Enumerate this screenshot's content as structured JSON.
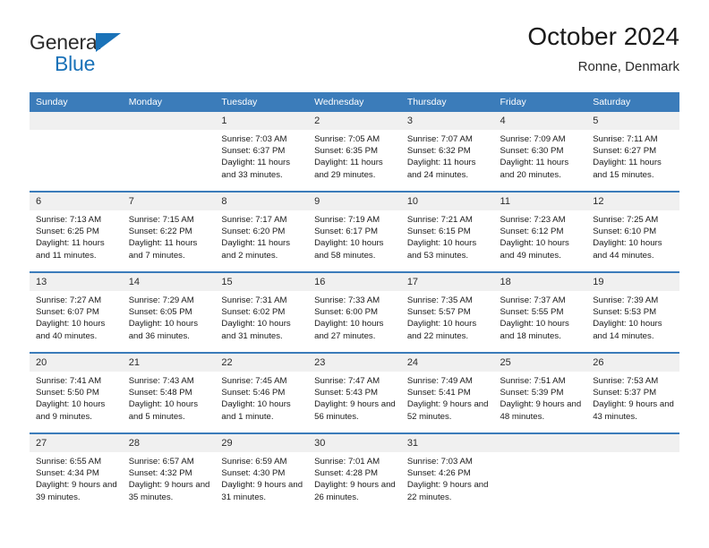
{
  "brand": {
    "name_part1": "General",
    "name_part2": "Blue",
    "accent_color": "#1a72b8"
  },
  "header": {
    "title": "October 2024",
    "subtitle": "Ronne, Denmark"
  },
  "theme": {
    "header_blue": "#3b7cba",
    "day_band_gray": "#f0f0f0",
    "text_color": "#1a1a1a"
  },
  "calendar": {
    "weekday_headers": [
      "Sunday",
      "Monday",
      "Tuesday",
      "Wednesday",
      "Thursday",
      "Friday",
      "Saturday"
    ],
    "labels": {
      "sunrise": "Sunrise:",
      "sunset": "Sunset:",
      "daylight": "Daylight:"
    },
    "weeks": [
      [
        {
          "day": "",
          "empty": true
        },
        {
          "day": "",
          "empty": true
        },
        {
          "day": "1",
          "sunrise": "Sunrise: 7:03 AM",
          "sunset": "Sunset: 6:37 PM",
          "daylight": "Daylight: 11 hours and 33 minutes."
        },
        {
          "day": "2",
          "sunrise": "Sunrise: 7:05 AM",
          "sunset": "Sunset: 6:35 PM",
          "daylight": "Daylight: 11 hours and 29 minutes."
        },
        {
          "day": "3",
          "sunrise": "Sunrise: 7:07 AM",
          "sunset": "Sunset: 6:32 PM",
          "daylight": "Daylight: 11 hours and 24 minutes."
        },
        {
          "day": "4",
          "sunrise": "Sunrise: 7:09 AM",
          "sunset": "Sunset: 6:30 PM",
          "daylight": "Daylight: 11 hours and 20 minutes."
        },
        {
          "day": "5",
          "sunrise": "Sunrise: 7:11 AM",
          "sunset": "Sunset: 6:27 PM",
          "daylight": "Daylight: 11 hours and 15 minutes."
        }
      ],
      [
        {
          "day": "6",
          "sunrise": "Sunrise: 7:13 AM",
          "sunset": "Sunset: 6:25 PM",
          "daylight": "Daylight: 11 hours and 11 minutes."
        },
        {
          "day": "7",
          "sunrise": "Sunrise: 7:15 AM",
          "sunset": "Sunset: 6:22 PM",
          "daylight": "Daylight: 11 hours and 7 minutes."
        },
        {
          "day": "8",
          "sunrise": "Sunrise: 7:17 AM",
          "sunset": "Sunset: 6:20 PM",
          "daylight": "Daylight: 11 hours and 2 minutes."
        },
        {
          "day": "9",
          "sunrise": "Sunrise: 7:19 AM",
          "sunset": "Sunset: 6:17 PM",
          "daylight": "Daylight: 10 hours and 58 minutes."
        },
        {
          "day": "10",
          "sunrise": "Sunrise: 7:21 AM",
          "sunset": "Sunset: 6:15 PM",
          "daylight": "Daylight: 10 hours and 53 minutes."
        },
        {
          "day": "11",
          "sunrise": "Sunrise: 7:23 AM",
          "sunset": "Sunset: 6:12 PM",
          "daylight": "Daylight: 10 hours and 49 minutes."
        },
        {
          "day": "12",
          "sunrise": "Sunrise: 7:25 AM",
          "sunset": "Sunset: 6:10 PM",
          "daylight": "Daylight: 10 hours and 44 minutes."
        }
      ],
      [
        {
          "day": "13",
          "sunrise": "Sunrise: 7:27 AM",
          "sunset": "Sunset: 6:07 PM",
          "daylight": "Daylight: 10 hours and 40 minutes."
        },
        {
          "day": "14",
          "sunrise": "Sunrise: 7:29 AM",
          "sunset": "Sunset: 6:05 PM",
          "daylight": "Daylight: 10 hours and 36 minutes."
        },
        {
          "day": "15",
          "sunrise": "Sunrise: 7:31 AM",
          "sunset": "Sunset: 6:02 PM",
          "daylight": "Daylight: 10 hours and 31 minutes."
        },
        {
          "day": "16",
          "sunrise": "Sunrise: 7:33 AM",
          "sunset": "Sunset: 6:00 PM",
          "daylight": "Daylight: 10 hours and 27 minutes."
        },
        {
          "day": "17",
          "sunrise": "Sunrise: 7:35 AM",
          "sunset": "Sunset: 5:57 PM",
          "daylight": "Daylight: 10 hours and 22 minutes."
        },
        {
          "day": "18",
          "sunrise": "Sunrise: 7:37 AM",
          "sunset": "Sunset: 5:55 PM",
          "daylight": "Daylight: 10 hours and 18 minutes."
        },
        {
          "day": "19",
          "sunrise": "Sunrise: 7:39 AM",
          "sunset": "Sunset: 5:53 PM",
          "daylight": "Daylight: 10 hours and 14 minutes."
        }
      ],
      [
        {
          "day": "20",
          "sunrise": "Sunrise: 7:41 AM",
          "sunset": "Sunset: 5:50 PM",
          "daylight": "Daylight: 10 hours and 9 minutes."
        },
        {
          "day": "21",
          "sunrise": "Sunrise: 7:43 AM",
          "sunset": "Sunset: 5:48 PM",
          "daylight": "Daylight: 10 hours and 5 minutes."
        },
        {
          "day": "22",
          "sunrise": "Sunrise: 7:45 AM",
          "sunset": "Sunset: 5:46 PM",
          "daylight": "Daylight: 10 hours and 1 minute."
        },
        {
          "day": "23",
          "sunrise": "Sunrise: 7:47 AM",
          "sunset": "Sunset: 5:43 PM",
          "daylight": "Daylight: 9 hours and 56 minutes."
        },
        {
          "day": "24",
          "sunrise": "Sunrise: 7:49 AM",
          "sunset": "Sunset: 5:41 PM",
          "daylight": "Daylight: 9 hours and 52 minutes."
        },
        {
          "day": "25",
          "sunrise": "Sunrise: 7:51 AM",
          "sunset": "Sunset: 5:39 PM",
          "daylight": "Daylight: 9 hours and 48 minutes."
        },
        {
          "day": "26",
          "sunrise": "Sunrise: 7:53 AM",
          "sunset": "Sunset: 5:37 PM",
          "daylight": "Daylight: 9 hours and 43 minutes."
        }
      ],
      [
        {
          "day": "27",
          "sunrise": "Sunrise: 6:55 AM",
          "sunset": "Sunset: 4:34 PM",
          "daylight": "Daylight: 9 hours and 39 minutes."
        },
        {
          "day": "28",
          "sunrise": "Sunrise: 6:57 AM",
          "sunset": "Sunset: 4:32 PM",
          "daylight": "Daylight: 9 hours and 35 minutes."
        },
        {
          "day": "29",
          "sunrise": "Sunrise: 6:59 AM",
          "sunset": "Sunset: 4:30 PM",
          "daylight": "Daylight: 9 hours and 31 minutes."
        },
        {
          "day": "30",
          "sunrise": "Sunrise: 7:01 AM",
          "sunset": "Sunset: 4:28 PM",
          "daylight": "Daylight: 9 hours and 26 minutes."
        },
        {
          "day": "31",
          "sunrise": "Sunrise: 7:03 AM",
          "sunset": "Sunset: 4:26 PM",
          "daylight": "Daylight: 9 hours and 22 minutes."
        },
        {
          "day": "",
          "empty": true
        },
        {
          "day": "",
          "empty": true
        }
      ]
    ]
  }
}
